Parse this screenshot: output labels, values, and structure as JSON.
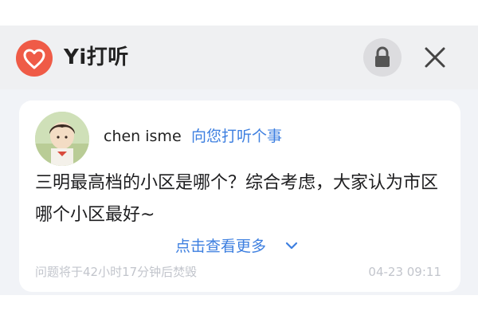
{
  "app": {
    "title": "Yi打听",
    "brand_color": "#ef5b47",
    "logo_icon": "heart-icon",
    "lock_icon": "lock-icon",
    "close_icon": "close-icon"
  },
  "post": {
    "username": "chen isme",
    "ask_link": "向您打听个事",
    "question": "三明最高档的小区是哪个？综合考虑，大家认为市区哪个小区最好~",
    "expand_label": "点击查看更多",
    "expiry_notice": "问题将于42小时17分钟后焚毁",
    "timestamp": "04-23 09:11",
    "link_color": "#3d7fe0"
  }
}
